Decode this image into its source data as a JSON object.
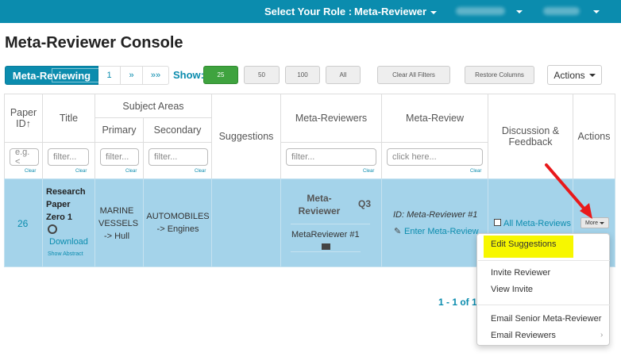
{
  "topbar": {
    "role_label": "Select Your Role :",
    "role_value": "Meta-Reviewer",
    "bg_color": "#0b8cae"
  },
  "page_title": "Meta-Reviewer Console",
  "pager": {
    "current_label": "Meta-Reviewing",
    "page_1": "1",
    "next": "»",
    "last": "»»"
  },
  "show": {
    "label": "Show:",
    "options": [
      "25",
      "50",
      "100",
      "All"
    ],
    "selected": "25"
  },
  "toolbar": {
    "clear_filters": "Clear All Filters",
    "restore_columns": "Restore Columns",
    "actions": "Actions"
  },
  "columns": {
    "paper_id": "Paper ID",
    "title": "Title",
    "subject_areas": "Subject Areas",
    "primary": "Primary",
    "secondary": "Secondary",
    "suggestions": "Suggestions",
    "meta_reviewers": "Meta-Reviewers",
    "meta_review": "Meta-Review",
    "discussion": "Discussion & Feedback",
    "actions": "Actions"
  },
  "filters": {
    "paper_id_placeholder": "e.g. <",
    "title_placeholder": "filter...",
    "primary_placeholder": "filter...",
    "secondary_placeholder": "filter...",
    "meta_reviewers_placeholder": "filter...",
    "meta_review_placeholder": "click here...",
    "clear": "Clear"
  },
  "row": {
    "paper_id": "26",
    "title": "Research Paper Zero 1",
    "download": "Download",
    "show_abstract": "Show Abstract",
    "primary": "MARINE VESSELS -> Hull",
    "secondary": "AUTOMOBILES -> Engines",
    "mr_role": "Meta-Reviewer",
    "mr_q": "Q3",
    "mr_name": "MetaReviewer #1",
    "review_id": "ID: Meta-Reviewer #1",
    "enter_review": "Enter Meta-Review",
    "all_meta_reviews": "All Meta-Reviews",
    "more": "More"
  },
  "menu": {
    "items": [
      "Edit Suggestions",
      "Invite Reviewer",
      "View Invite",
      "Email Senior Meta-Reviewer",
      "Email Reviewers"
    ],
    "highlight_color": "#f7f700"
  },
  "footer": {
    "count": "1 - 1 of 1"
  },
  "colors": {
    "accent": "#0b8cae",
    "selected_row": "#a4d3ea",
    "active_green": "#3fa33f",
    "arrow_red": "#e8191b"
  }
}
